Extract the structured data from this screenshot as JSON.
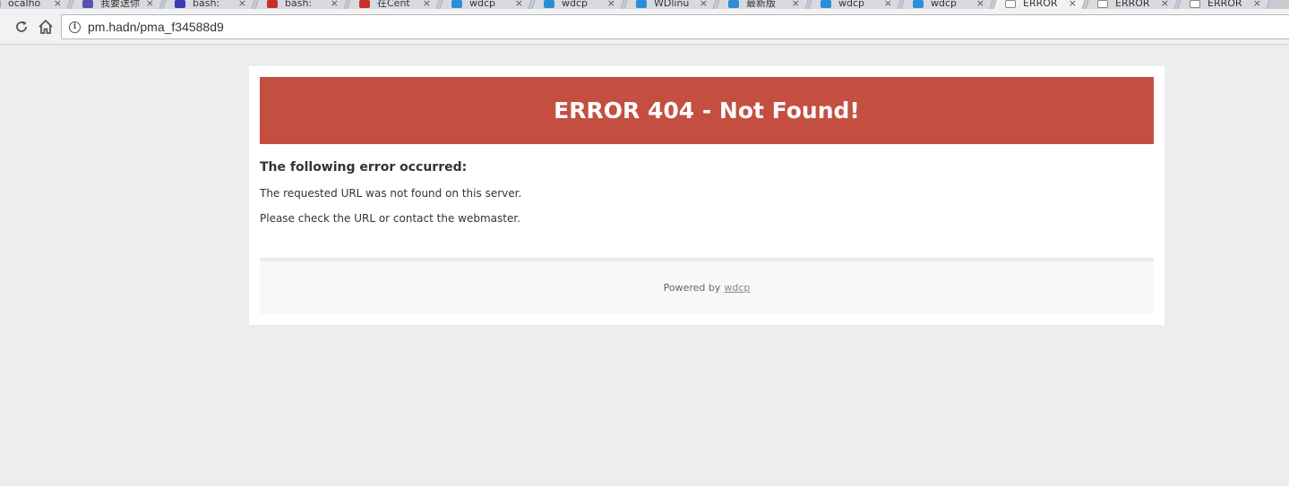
{
  "tabs": [
    {
      "title": "ocalho",
      "favicon_color": "#9aa3ad"
    },
    {
      "title": "我要送你",
      "favicon_color": "#5a4fb3"
    },
    {
      "title": "bash:",
      "favicon_color": "#3b3bb3"
    },
    {
      "title": "bash:",
      "favicon_color": "#c9302c"
    },
    {
      "title": "在Cent",
      "favicon_color": "#c9302c"
    },
    {
      "title": "wdcp",
      "favicon_color": "#2b8fd6"
    },
    {
      "title": "wdcp",
      "favicon_color": "#2b8fd6"
    },
    {
      "title": "WDlinu",
      "favicon_color": "#2b8fd6"
    },
    {
      "title": "最新版",
      "favicon_color": "#2b8fd6"
    },
    {
      "title": "wdcp",
      "favicon_color": "#2b8fd6"
    },
    {
      "title": "wdcp",
      "favicon_color": "#2b8fd6"
    },
    {
      "title": "ERROR",
      "favicon_color": "#ffffff",
      "active": true
    },
    {
      "title": "ERROR",
      "favicon_color": "#ffffff"
    },
    {
      "title": "ERROR",
      "favicon_color": "#ffffff"
    }
  ],
  "tab_close_glyph": "×",
  "address_bar": {
    "url": "pm.hadn/pma_f34588d9",
    "info_glyph": "i"
  },
  "error": {
    "banner_title": "ERROR 404 - Not Found!",
    "banner_color": "#c44f41",
    "heading": "The following error occurred:",
    "message_1": "The requested URL was not found on this server.",
    "message_2": "Please check the URL or contact the webmaster.",
    "footer_prefix": "Powered by",
    "footer_link": "wdcp"
  }
}
